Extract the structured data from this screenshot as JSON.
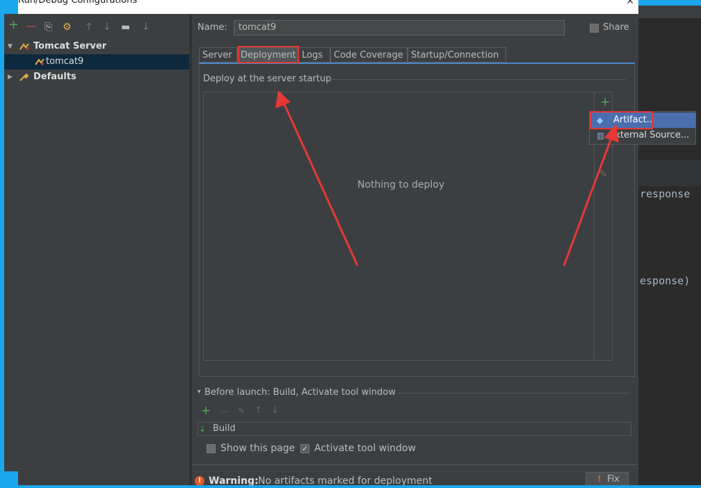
{
  "window": {
    "title": "Run/Debug Configurations",
    "close_glyph": "✕"
  },
  "toolbar": {
    "add": "+",
    "remove": "—",
    "copy": "⎘",
    "settings": "⚙",
    "move_up": "↑",
    "move_down": "↓",
    "folder": "▬",
    "sort": "↓"
  },
  "tree": {
    "server_group_label": "Tomcat Server",
    "server_item_label": "tomcat9",
    "defaults_label": "Defaults",
    "expanded_glyph": "▼",
    "collapsed_glyph": "▶"
  },
  "form": {
    "name_label": "Name:",
    "name_value": "tomcat9",
    "share_label": "Share"
  },
  "tabs": [
    {
      "label": "Server"
    },
    {
      "label": "Deployment"
    },
    {
      "label": "Logs"
    },
    {
      "label": "Code Coverage"
    },
    {
      "label": "Startup/Connection"
    }
  ],
  "deployment": {
    "section_label": "Deploy at the server startup",
    "empty_text": "Nothing to deploy",
    "add_glyph": "+",
    "edit_glyph": "✎",
    "popup_items": [
      {
        "label": "Artifact..",
        "icon": "◆"
      },
      {
        "label": "External Source...",
        "icon": "▥"
      }
    ]
  },
  "before_launch": {
    "label": "Before launch: Build, Activate tool window",
    "toggle_glyph": "▾",
    "add": "+",
    "remove": "—",
    "edit": "✎",
    "up": "↑",
    "down": "↓",
    "build_item": "Build",
    "build_icon": "⇣",
    "show_page_label": "Show this page",
    "activate_label": "Activate tool window",
    "check_glyph": "✓"
  },
  "warning": {
    "label": "Warning:",
    "text": " No artifacts marked for deployment",
    "fix_label": "Fix",
    "icon": "!"
  },
  "editor": {
    "line1": "response",
    "line2": "esponse)"
  },
  "colors": {
    "dialog_bg": "#3c3f41",
    "frame": "#1aa7ec",
    "highlight": "#e53935",
    "selection": "#4b6eaf",
    "add_green": "#4caf50"
  }
}
